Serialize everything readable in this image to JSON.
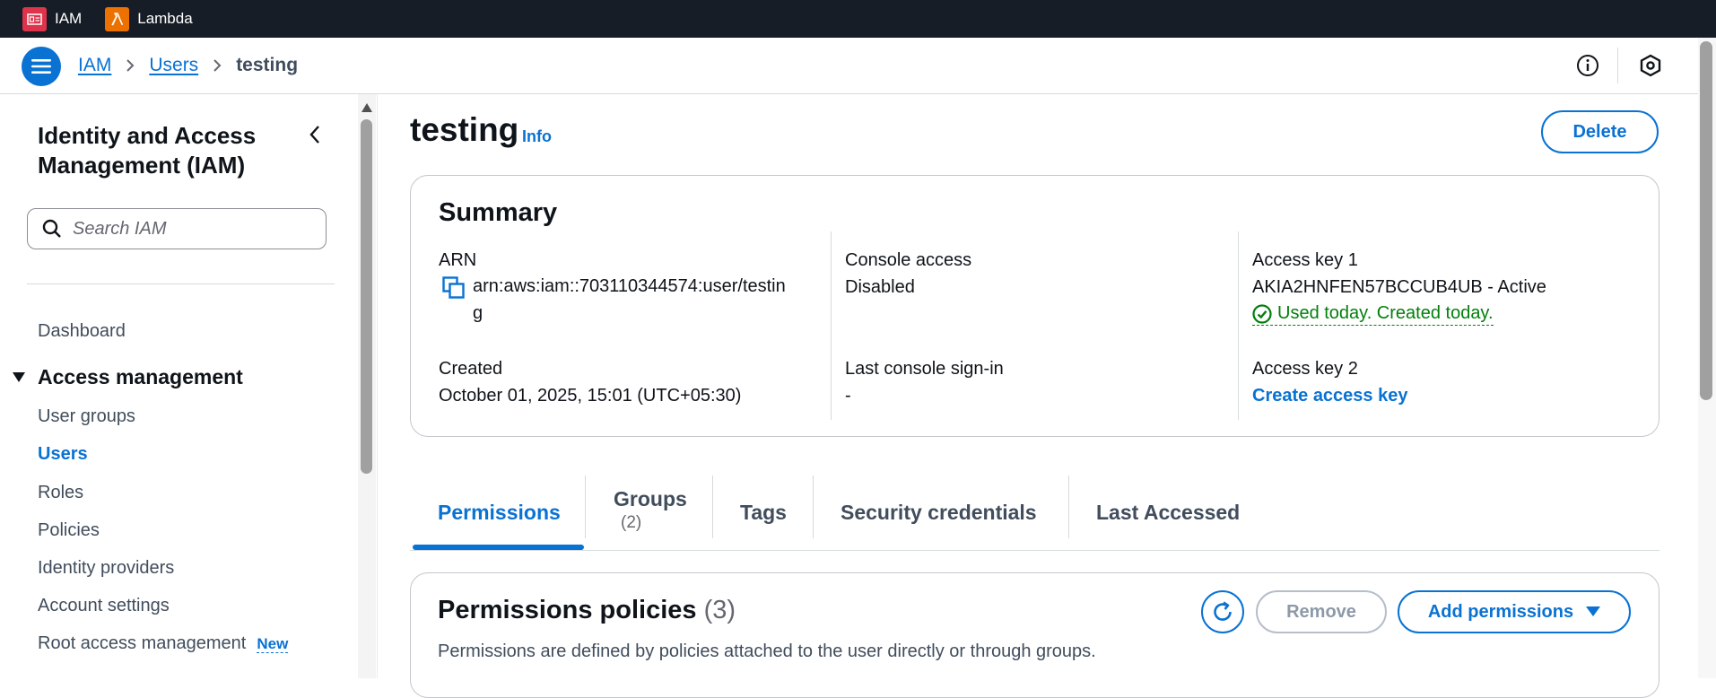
{
  "top_bar": {
    "services": [
      {
        "label": "IAM",
        "icon": "iam-icon",
        "color": "#dd344c"
      },
      {
        "label": "Lambda",
        "icon": "lambda-icon",
        "color": "#ed7100"
      }
    ]
  },
  "header": {
    "breadcrumbs": [
      {
        "label": "IAM"
      },
      {
        "label": "Users"
      },
      {
        "label": "testing"
      }
    ],
    "icons": [
      "info-circle-icon",
      "settings-hex-icon"
    ]
  },
  "sidebar": {
    "title": "Identity and Access Management (IAM)",
    "search_placeholder": "Search IAM",
    "dashboard": "Dashboard",
    "section_label": "Access management",
    "items": [
      {
        "label": "User groups"
      },
      {
        "label": "Users",
        "active": true
      },
      {
        "label": "Roles"
      },
      {
        "label": "Policies"
      },
      {
        "label": "Identity providers"
      },
      {
        "label": "Account settings"
      },
      {
        "label": "Root access management",
        "badge": "New"
      }
    ]
  },
  "page": {
    "title": "testing",
    "info_label": "Info",
    "delete_label": "Delete"
  },
  "summary": {
    "title": "Summary",
    "arn_label": "ARN",
    "arn_value_line1": "arn:aws:iam::703110344574:user/testin",
    "arn_value_line2": "g",
    "created_label": "Created",
    "created_value": "October 01, 2025, 15:01 (UTC+05:30)",
    "console_access_label": "Console access",
    "console_access_value": "Disabled",
    "last_signin_label": "Last console sign-in",
    "last_signin_value": "-",
    "access_key1_label": "Access key 1",
    "access_key1_value": "AKIA2HNFEN57BCCUB4UB - Active",
    "access_key1_status": "Used today. Created today.",
    "access_key2_label": "Access key 2",
    "access_key2_action": "Create access key"
  },
  "tabs": [
    {
      "label": "Permissions",
      "active": true
    },
    {
      "label": "Groups",
      "count": "(2)"
    },
    {
      "label": "Tags"
    },
    {
      "label": "Security credentials"
    },
    {
      "label": "Last Accessed"
    }
  ],
  "permissions": {
    "title": "Permissions policies",
    "count": "(3)",
    "description": "Permissions are defined by policies attached to the user directly or through groups.",
    "remove_label": "Remove",
    "add_label": "Add permissions"
  },
  "colors": {
    "accent": "#0972d3",
    "success": "#037f0c",
    "topbar": "#161d26"
  }
}
